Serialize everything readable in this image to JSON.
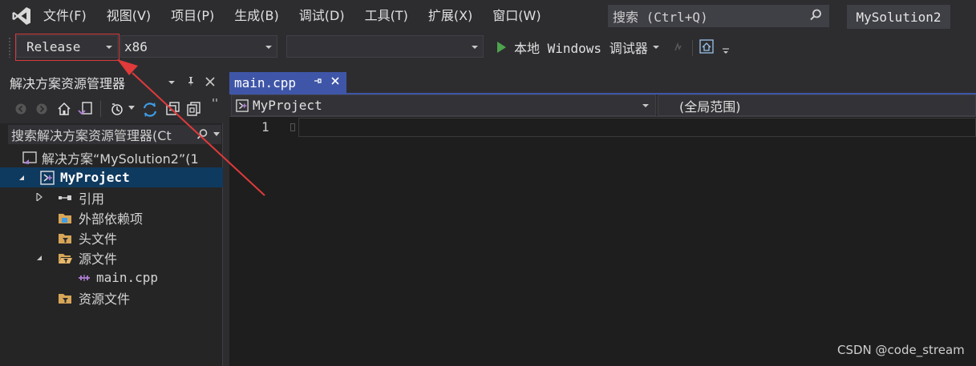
{
  "menubar": {
    "items": [
      "文件(F)",
      "视图(V)",
      "项目(P)",
      "生成(B)",
      "调试(D)",
      "工具(T)",
      "扩展(X)",
      "窗口(W)"
    ],
    "search_placeholder": "搜索 (Ctrl+Q)",
    "solution_name": "MySolution2"
  },
  "toolbar": {
    "configuration": "Release",
    "platform": "x86",
    "startup_item": "",
    "run_label": "本地 Windows 调试器"
  },
  "explorer": {
    "title": "解决方案资源管理器",
    "search_placeholder": "搜索解决方案资源管理器(Ct",
    "tree": [
      {
        "label": "解决方案“MySolution2”(1",
        "icon": "solution-icon",
        "level": 0
      },
      {
        "label": "MyProject",
        "icon": "cpp-project-icon",
        "level": 0,
        "expanded": true,
        "selected": true
      },
      {
        "label": "引用",
        "icon": "references-icon",
        "level": 1,
        "expanded": false
      },
      {
        "label": "外部依赖项",
        "icon": "external-deps-icon",
        "level": 1
      },
      {
        "label": "头文件",
        "icon": "filter-folder-icon",
        "level": 1
      },
      {
        "label": "源文件",
        "icon": "filter-folder-open-icon",
        "level": 1,
        "expanded": true
      },
      {
        "label": "main.cpp",
        "icon": "cpp-file-icon",
        "level": 2
      },
      {
        "label": "资源文件",
        "icon": "filter-folder-icon",
        "level": 1
      }
    ]
  },
  "editor": {
    "tab_label": "main.cpp",
    "project_scope": "MyProject",
    "member_scope": "(全局范围)",
    "line_numbers": [
      "1"
    ]
  },
  "watermark": "CSDN @code_stream",
  "colors": {
    "accent_tab": "#3f56a8",
    "selection": "#0f3a5f",
    "highlight_box": "#d83b3b",
    "run_green": "#4ea34e"
  }
}
